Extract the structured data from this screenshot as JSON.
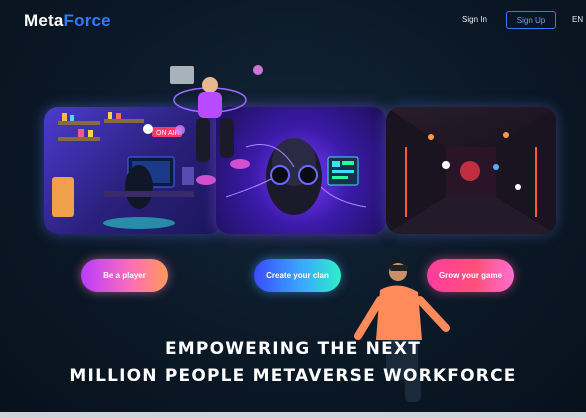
{
  "header": {
    "logo_part1": "Meta",
    "logo_part2": "Force",
    "signin_label": "Sign In",
    "signup_label": "Sign Up",
    "language": "EN"
  },
  "panels": [
    {
      "name": "gaming-room-illustration",
      "accent": "#ff4fa0"
    },
    {
      "name": "cyber-head-illustration",
      "accent": "#3ce0ff"
    },
    {
      "name": "neon-corridor-illustration",
      "accent": "#ff7a2a"
    }
  ],
  "buttons": {
    "player": "Be a player",
    "clan": "Create your clan",
    "game": "Grow your game"
  },
  "headline": {
    "line1": "EMPOWERING THE NEXT",
    "line2": "MILLION PEOPLE METAVERSE WORKFORCE"
  },
  "colors": {
    "background": "#0b1826",
    "brand_blue": "#2f7bff",
    "signup_border": "#2e7cff"
  }
}
